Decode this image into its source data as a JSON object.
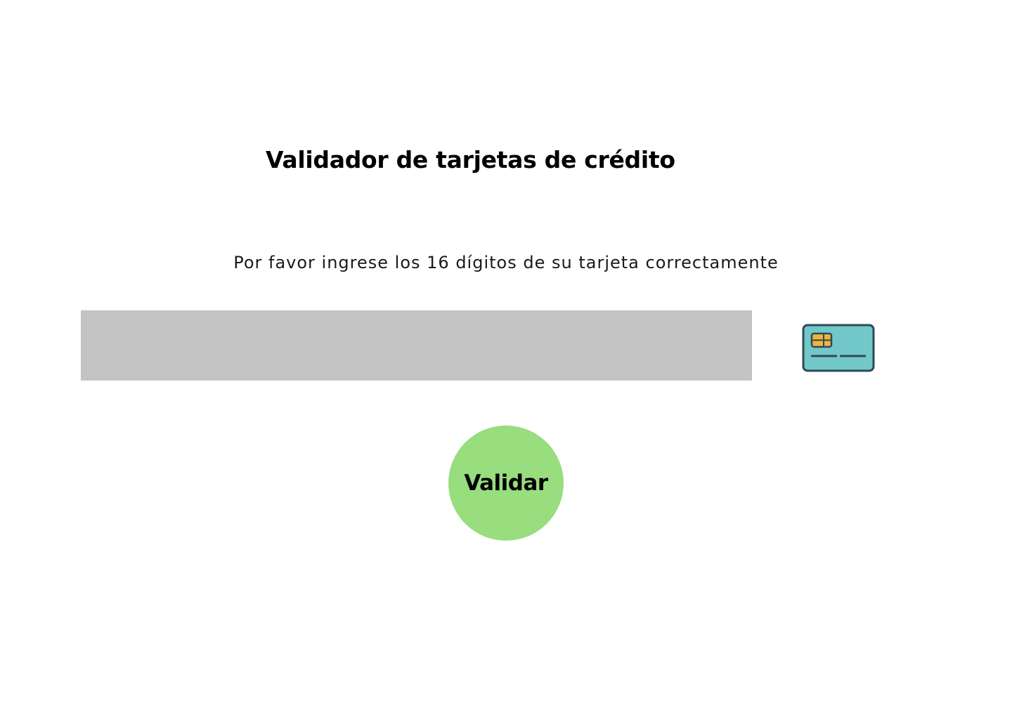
{
  "header": {
    "title": "Validador de tarjetas de crédito"
  },
  "form": {
    "instruction": "Por favor ingrese los 16 dígitos de su tarjeta correctamente",
    "card_number_value": "",
    "card_number_placeholder": "",
    "validate_label": "Validar"
  },
  "icons": {
    "card": "credit-card-icon"
  },
  "colors": {
    "input_background": "#c4c4c4",
    "button_background": "#98dd7e",
    "card_body": "#72c8c8",
    "card_outline": "#2e4a56",
    "card_chip": "#f0b43c"
  }
}
